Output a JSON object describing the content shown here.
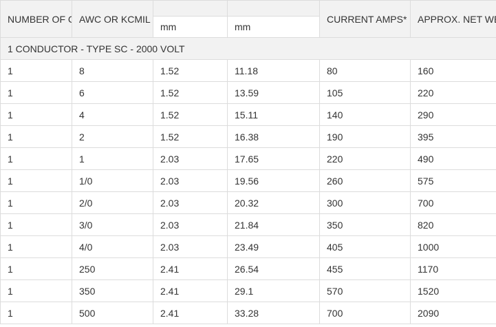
{
  "headers": {
    "number_of_cond": "NUMBER OF COND.",
    "awc_or_kcmil": "AWC OR KCMIL",
    "insulation_unit": "mm",
    "diameter_unit": "mm",
    "current_amps": "CURRENT AMPS*",
    "approx_weight": "APPROX. NET WEIGHT LBS/M'*"
  },
  "section_title": "1 CONDUCTOR - TYPE SC - 2000 VOLT",
  "rows": [
    {
      "cond": "1",
      "size": "8",
      "insulation": "1.52",
      "diameter": "11.18",
      "amps": "80",
      "weight": "160"
    },
    {
      "cond": "1",
      "size": "6",
      "insulation": "1.52",
      "diameter": "13.59",
      "amps": "105",
      "weight": "220"
    },
    {
      "cond": "1",
      "size": "4",
      "insulation": "1.52",
      "diameter": "15.11",
      "amps": "140",
      "weight": "290"
    },
    {
      "cond": "1",
      "size": "2",
      "insulation": "1.52",
      "diameter": "16.38",
      "amps": "190",
      "weight": "395"
    },
    {
      "cond": "1",
      "size": "1",
      "insulation": "2.03",
      "diameter": "17.65",
      "amps": "220",
      "weight": "490"
    },
    {
      "cond": "1",
      "size": "1/0",
      "insulation": "2.03",
      "diameter": "19.56",
      "amps": "260",
      "weight": "575"
    },
    {
      "cond": "1",
      "size": "2/0",
      "insulation": "2.03",
      "diameter": "20.32",
      "amps": "300",
      "weight": "700"
    },
    {
      "cond": "1",
      "size": "3/0",
      "insulation": "2.03",
      "diameter": "21.84",
      "amps": "350",
      "weight": "820"
    },
    {
      "cond": "1",
      "size": "4/0",
      "insulation": "2.03",
      "diameter": "23.49",
      "amps": "405",
      "weight": "1000"
    },
    {
      "cond": "1",
      "size": "250",
      "insulation": "2.41",
      "diameter": "26.54",
      "amps": "455",
      "weight": "1170"
    },
    {
      "cond": "1",
      "size": "350",
      "insulation": "2.41",
      "diameter": "29.1",
      "amps": "570",
      "weight": "1520"
    },
    {
      "cond": "1",
      "size": "500",
      "insulation": "2.41",
      "diameter": "33.28",
      "amps": "700",
      "weight": "2090"
    }
  ]
}
